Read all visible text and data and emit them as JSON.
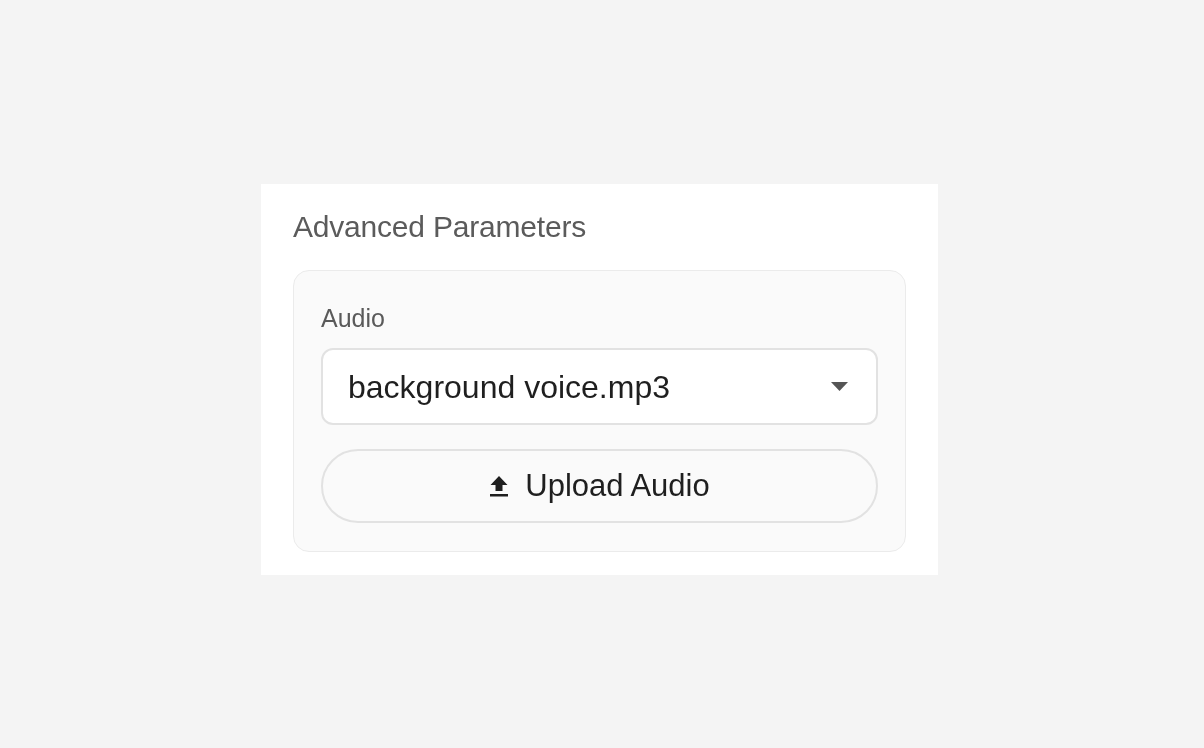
{
  "section": {
    "title": "Advanced Parameters"
  },
  "audio_field": {
    "label": "Audio",
    "value": "background voice.mp3"
  },
  "upload_button": {
    "label": "Upload Audio"
  }
}
